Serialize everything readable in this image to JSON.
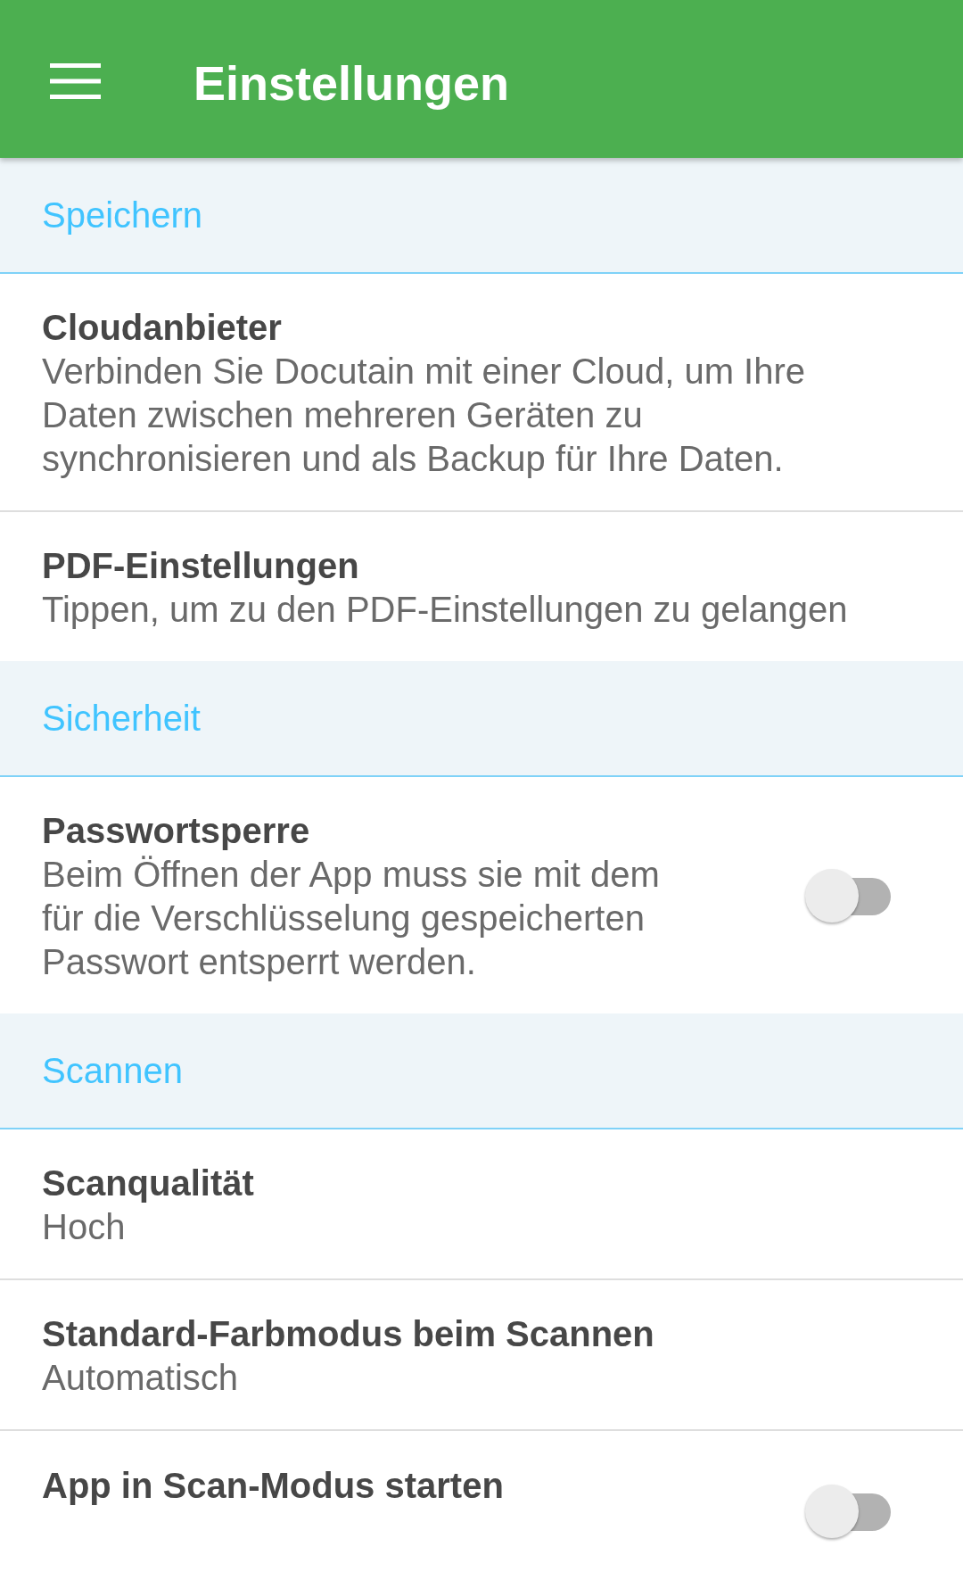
{
  "app_bar": {
    "title": "Einstellungen"
  },
  "sections": [
    {
      "title": "Speichern",
      "items": [
        {
          "kind": "entry",
          "title": "Cloudanbieter",
          "summary": "Verbinden Sie Docutain mit einer Cloud, um Ihre Daten zwischen mehreren Geräten zu synchronisieren und als Backup für Ihre Daten."
        },
        {
          "kind": "entry",
          "title": "PDF-Einstellungen",
          "summary": "Tippen, um zu den PDF-Einstellungen zu gelangen"
        }
      ]
    },
    {
      "title": "Sicherheit",
      "items": [
        {
          "kind": "switch",
          "title": "Passwortsperre",
          "summary": "Beim Öffnen der App muss sie mit dem für die Verschlüsselung gespeicherten Passwort entsperrt werden.",
          "on": false
        }
      ]
    },
    {
      "title": "Scannen",
      "items": [
        {
          "kind": "entry",
          "title": "Scanqualität",
          "summary": "Hoch"
        },
        {
          "kind": "entry",
          "title": "Standard-Farbmodus beim Scannen",
          "summary": "Automatisch"
        },
        {
          "kind": "switch",
          "title": "App in Scan-Modus starten",
          "on": false
        }
      ]
    }
  ]
}
